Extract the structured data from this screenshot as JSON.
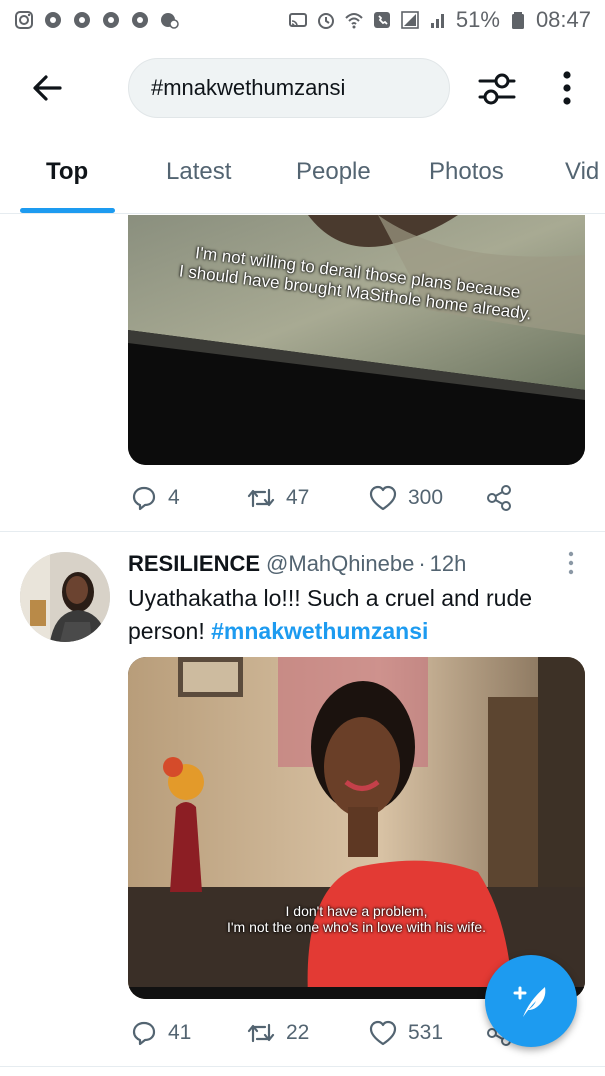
{
  "status_bar": {
    "battery": "51%",
    "time": "08:47"
  },
  "header": {
    "search_query": "#mnakwethumzansi"
  },
  "tabs": [
    {
      "label": "Top",
      "active": true
    },
    {
      "label": "Latest",
      "active": false
    },
    {
      "label": "People",
      "active": false
    },
    {
      "label": "Photos",
      "active": false
    },
    {
      "label": "Vid",
      "active": false
    }
  ],
  "tweet1": {
    "subtitle_line1": "I'm not willing to derail those plans because",
    "subtitle_line2": "I should have brought MaSithole home already.",
    "replies": "4",
    "retweets": "47",
    "likes": "300"
  },
  "tweet2": {
    "name": "RESILIENCE",
    "handle": "@MahQhinebe",
    "separator": "·",
    "time": "12h",
    "text": "Uyathakatha lo!!! Such a cruel and rude person!",
    "hashtag": "#mnakwethumzansi",
    "subtitle_line1": "I don't have a problem,",
    "subtitle_line2": "I'm not the one who's in love with his wife.",
    "replies": "41",
    "retweets": "22",
    "likes": "531"
  },
  "colors": {
    "accent": "#1d9bf0",
    "text_primary": "#0f1419",
    "text_secondary": "#536471"
  }
}
